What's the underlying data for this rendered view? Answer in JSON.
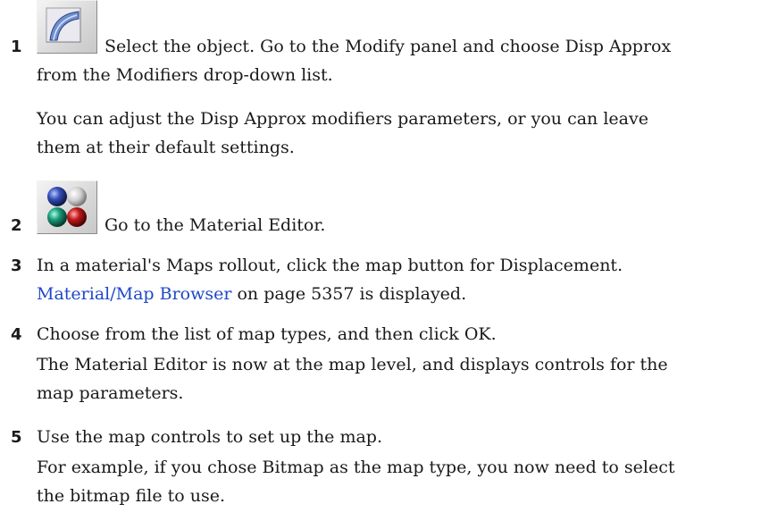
{
  "steps": [
    {
      "number": "1",
      "icon": "curve-surface-icon",
      "lines": [
        "Select the object. Go to the Modify panel and choose Disp Approx",
        "from the Modifiers drop-down list."
      ],
      "note_lines": [
        "You can adjust the Disp Approx modifiers parameters, or you can leave",
        "them at their default settings."
      ]
    },
    {
      "number": "2",
      "icon": "material-spheres-icon",
      "text": "Go to the Material Editor."
    },
    {
      "number": "3",
      "text": "In a material's Maps rollout, click the map button for Displacement.",
      "note_link": "Material/Map Browser",
      "note_rest": " on page 5357 is displayed."
    },
    {
      "number": "4",
      "text": "Choose from the list of map types, and then click OK.",
      "note_lines": [
        "The Material Editor is now at the map level, and displays controls for the",
        "map parameters."
      ]
    },
    {
      "number": "5",
      "text": "Use the map controls to set up the map.",
      "note_lines": [
        "For example, if you chose Bitmap as the map type, you now need to select",
        "the bitmap file to use."
      ]
    }
  ],
  "colors": {
    "link": "#1f48c8",
    "text": "#1a1a1a"
  }
}
